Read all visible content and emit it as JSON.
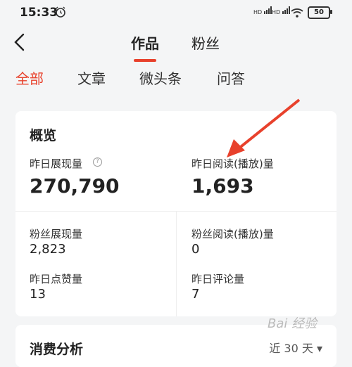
{
  "status": {
    "time": "15:33",
    "battery": "50",
    "signal1": "HD",
    "signal2": "HD"
  },
  "header": {
    "tabs": [
      {
        "label": "作品",
        "active": true
      },
      {
        "label": "粉丝",
        "active": false
      }
    ]
  },
  "subtabs": [
    {
      "label": "全部",
      "active": true
    },
    {
      "label": "文章"
    },
    {
      "label": "微头条"
    },
    {
      "label": "问答"
    }
  ],
  "overview": {
    "title": "概览",
    "yesterday_impressions": {
      "label": "昨日展现量",
      "value": "270,790"
    },
    "yesterday_reads": {
      "label": "昨日阅读(播放)量",
      "value": "1,693"
    },
    "fan_impressions": {
      "label": "粉丝展现量",
      "value": "2,823"
    },
    "fan_reads": {
      "label": "粉丝阅读(播放)量",
      "value": "0"
    },
    "yesterday_likes": {
      "label": "昨日点赞量",
      "value": "13"
    },
    "yesterday_comments": {
      "label": "昨日评论量",
      "value": "7"
    }
  },
  "analysis": {
    "title": "消费分析",
    "range": "近 30 天 ▾"
  },
  "watermark": "Bai 经验",
  "colors": {
    "accent": "#e8412c",
    "background": "#f4f5f6",
    "card": "#ffffff"
  }
}
